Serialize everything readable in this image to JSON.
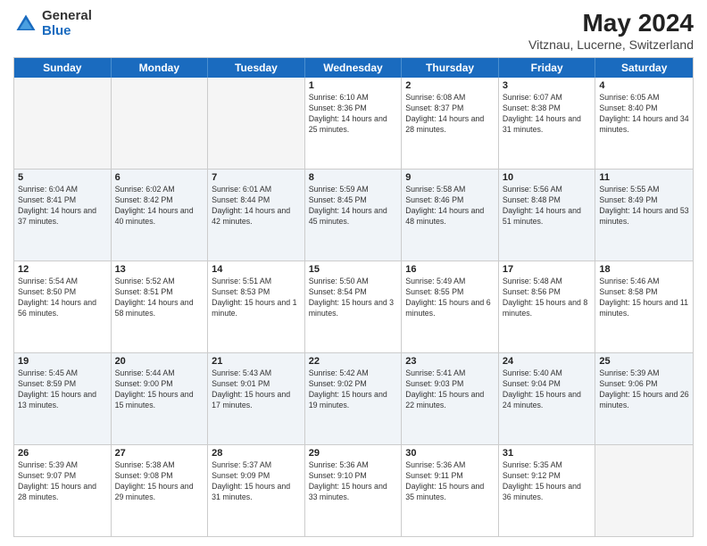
{
  "header": {
    "logo_general": "General",
    "logo_blue": "Blue",
    "title": "May 2024",
    "subtitle": "Vitznau, Lucerne, Switzerland"
  },
  "weekdays": [
    "Sunday",
    "Monday",
    "Tuesday",
    "Wednesday",
    "Thursday",
    "Friday",
    "Saturday"
  ],
  "rows": [
    [
      {
        "day": "",
        "empty": true
      },
      {
        "day": "",
        "empty": true
      },
      {
        "day": "",
        "empty": true
      },
      {
        "day": "1",
        "sunrise": "6:10 AM",
        "sunset": "8:36 PM",
        "daylight": "14 hours and 25 minutes."
      },
      {
        "day": "2",
        "sunrise": "6:08 AM",
        "sunset": "8:37 PM",
        "daylight": "14 hours and 28 minutes."
      },
      {
        "day": "3",
        "sunrise": "6:07 AM",
        "sunset": "8:38 PM",
        "daylight": "14 hours and 31 minutes."
      },
      {
        "day": "4",
        "sunrise": "6:05 AM",
        "sunset": "8:40 PM",
        "daylight": "14 hours and 34 minutes."
      }
    ],
    [
      {
        "day": "5",
        "sunrise": "6:04 AM",
        "sunset": "8:41 PM",
        "daylight": "14 hours and 37 minutes."
      },
      {
        "day": "6",
        "sunrise": "6:02 AM",
        "sunset": "8:42 PM",
        "daylight": "14 hours and 40 minutes."
      },
      {
        "day": "7",
        "sunrise": "6:01 AM",
        "sunset": "8:44 PM",
        "daylight": "14 hours and 42 minutes."
      },
      {
        "day": "8",
        "sunrise": "5:59 AM",
        "sunset": "8:45 PM",
        "daylight": "14 hours and 45 minutes."
      },
      {
        "day": "9",
        "sunrise": "5:58 AM",
        "sunset": "8:46 PM",
        "daylight": "14 hours and 48 minutes."
      },
      {
        "day": "10",
        "sunrise": "5:56 AM",
        "sunset": "8:48 PM",
        "daylight": "14 hours and 51 minutes."
      },
      {
        "day": "11",
        "sunrise": "5:55 AM",
        "sunset": "8:49 PM",
        "daylight": "14 hours and 53 minutes."
      }
    ],
    [
      {
        "day": "12",
        "sunrise": "5:54 AM",
        "sunset": "8:50 PM",
        "daylight": "14 hours and 56 minutes."
      },
      {
        "day": "13",
        "sunrise": "5:52 AM",
        "sunset": "8:51 PM",
        "daylight": "14 hours and 58 minutes."
      },
      {
        "day": "14",
        "sunrise": "5:51 AM",
        "sunset": "8:53 PM",
        "daylight": "15 hours and 1 minute."
      },
      {
        "day": "15",
        "sunrise": "5:50 AM",
        "sunset": "8:54 PM",
        "daylight": "15 hours and 3 minutes."
      },
      {
        "day": "16",
        "sunrise": "5:49 AM",
        "sunset": "8:55 PM",
        "daylight": "15 hours and 6 minutes."
      },
      {
        "day": "17",
        "sunrise": "5:48 AM",
        "sunset": "8:56 PM",
        "daylight": "15 hours and 8 minutes."
      },
      {
        "day": "18",
        "sunrise": "5:46 AM",
        "sunset": "8:58 PM",
        "daylight": "15 hours and 11 minutes."
      }
    ],
    [
      {
        "day": "19",
        "sunrise": "5:45 AM",
        "sunset": "8:59 PM",
        "daylight": "15 hours and 13 minutes."
      },
      {
        "day": "20",
        "sunrise": "5:44 AM",
        "sunset": "9:00 PM",
        "daylight": "15 hours and 15 minutes."
      },
      {
        "day": "21",
        "sunrise": "5:43 AM",
        "sunset": "9:01 PM",
        "daylight": "15 hours and 17 minutes."
      },
      {
        "day": "22",
        "sunrise": "5:42 AM",
        "sunset": "9:02 PM",
        "daylight": "15 hours and 19 minutes."
      },
      {
        "day": "23",
        "sunrise": "5:41 AM",
        "sunset": "9:03 PM",
        "daylight": "15 hours and 22 minutes."
      },
      {
        "day": "24",
        "sunrise": "5:40 AM",
        "sunset": "9:04 PM",
        "daylight": "15 hours and 24 minutes."
      },
      {
        "day": "25",
        "sunrise": "5:39 AM",
        "sunset": "9:06 PM",
        "daylight": "15 hours and 26 minutes."
      }
    ],
    [
      {
        "day": "26",
        "sunrise": "5:39 AM",
        "sunset": "9:07 PM",
        "daylight": "15 hours and 28 minutes."
      },
      {
        "day": "27",
        "sunrise": "5:38 AM",
        "sunset": "9:08 PM",
        "daylight": "15 hours and 29 minutes."
      },
      {
        "day": "28",
        "sunrise": "5:37 AM",
        "sunset": "9:09 PM",
        "daylight": "15 hours and 31 minutes."
      },
      {
        "day": "29",
        "sunrise": "5:36 AM",
        "sunset": "9:10 PM",
        "daylight": "15 hours and 33 minutes."
      },
      {
        "day": "30",
        "sunrise": "5:36 AM",
        "sunset": "9:11 PM",
        "daylight": "15 hours and 35 minutes."
      },
      {
        "day": "31",
        "sunrise": "5:35 AM",
        "sunset": "9:12 PM",
        "daylight": "15 hours and 36 minutes."
      },
      {
        "day": "",
        "empty": true
      }
    ]
  ]
}
